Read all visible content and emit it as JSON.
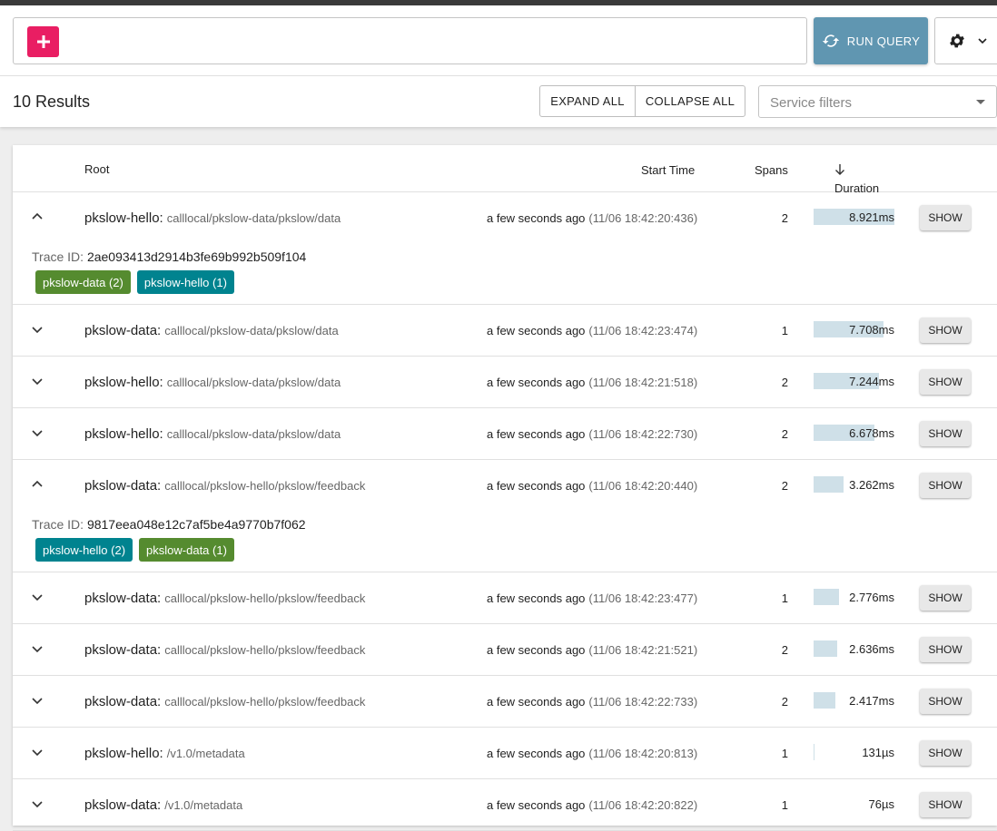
{
  "query": {
    "add_label": "+",
    "run_label": "RUN QUERY"
  },
  "results": {
    "count_label": "10 Results",
    "expand_all": "EXPAND ALL",
    "collapse_all": "COLLAPSE ALL",
    "service_filter_placeholder": "Service filters"
  },
  "columns": {
    "root": "Root",
    "start_time": "Start Time",
    "spans": "Spans",
    "duration": "Duration"
  },
  "colors": {
    "add_button": "#e91e63",
    "run_button": "#6096b1",
    "duration_bar": "#cfe0e8",
    "chip_pkslow_data": "#558b2f",
    "chip_pkslow_hello": "#00838f"
  },
  "rows": [
    {
      "service": "pkslow-hello:",
      "operation": "calllocal/pkslow-data/pkslow/data",
      "relative": "a few seconds ago",
      "timestamp": "(11/06 18:42:20:436)",
      "spans": "2",
      "duration": "8.921ms",
      "duration_fraction": 1.0,
      "expanded": true,
      "show": "SHOW",
      "trace_label": "Trace ID:",
      "trace_id": "2ae093413d2914b3fe69b992b509f104",
      "chips": [
        {
          "label": "pkslow-data (2)",
          "color": "#558b2f"
        },
        {
          "label": "pkslow-hello (1)",
          "color": "#00838f"
        }
      ]
    },
    {
      "service": "pkslow-data:",
      "operation": "calllocal/pkslow-data/pkslow/data",
      "relative": "a few seconds ago",
      "timestamp": "(11/06 18:42:23:474)",
      "spans": "1",
      "duration": "7.708ms",
      "duration_fraction": 0.864,
      "expanded": false,
      "show": "SHOW"
    },
    {
      "service": "pkslow-hello:",
      "operation": "calllocal/pkslow-data/pkslow/data",
      "relative": "a few seconds ago",
      "timestamp": "(11/06 18:42:21:518)",
      "spans": "2",
      "duration": "7.244ms",
      "duration_fraction": 0.812,
      "expanded": false,
      "show": "SHOW"
    },
    {
      "service": "pkslow-hello:",
      "operation": "calllocal/pkslow-data/pkslow/data",
      "relative": "a few seconds ago",
      "timestamp": "(11/06 18:42:22:730)",
      "spans": "2",
      "duration": "6.678ms",
      "duration_fraction": 0.749,
      "expanded": false,
      "show": "SHOW"
    },
    {
      "service": "pkslow-data:",
      "operation": "calllocal/pkslow-hello/pkslow/feedback",
      "relative": "a few seconds ago",
      "timestamp": "(11/06 18:42:20:440)",
      "spans": "2",
      "duration": "3.262ms",
      "duration_fraction": 0.366,
      "expanded": true,
      "show": "SHOW",
      "trace_label": "Trace ID:",
      "trace_id": "9817eea048e12c7af5be4a9770b7f062",
      "chips": [
        {
          "label": "pkslow-hello (2)",
          "color": "#00838f"
        },
        {
          "label": "pkslow-data (1)",
          "color": "#558b2f"
        }
      ]
    },
    {
      "service": "pkslow-data:",
      "operation": "calllocal/pkslow-hello/pkslow/feedback",
      "relative": "a few seconds ago",
      "timestamp": "(11/06 18:42:23:477)",
      "spans": "1",
      "duration": "2.776ms",
      "duration_fraction": 0.311,
      "expanded": false,
      "show": "SHOW"
    },
    {
      "service": "pkslow-data:",
      "operation": "calllocal/pkslow-hello/pkslow/feedback",
      "relative": "a few seconds ago",
      "timestamp": "(11/06 18:42:21:521)",
      "spans": "2",
      "duration": "2.636ms",
      "duration_fraction": 0.295,
      "expanded": false,
      "show": "SHOW"
    },
    {
      "service": "pkslow-data:",
      "operation": "calllocal/pkslow-hello/pkslow/feedback",
      "relative": "a few seconds ago",
      "timestamp": "(11/06 18:42:22:733)",
      "spans": "2",
      "duration": "2.417ms",
      "duration_fraction": 0.271,
      "expanded": false,
      "show": "SHOW"
    },
    {
      "service": "pkslow-hello:",
      "operation": "/v1.0/metadata",
      "relative": "a few seconds ago",
      "timestamp": "(11/06 18:42:20:813)",
      "spans": "1",
      "duration": "131µs",
      "duration_fraction": 0.015,
      "expanded": false,
      "show": "SHOW"
    },
    {
      "service": "pkslow-data:",
      "operation": "/v1.0/metadata",
      "relative": "a few seconds ago",
      "timestamp": "(11/06 18:42:20:822)",
      "spans": "1",
      "duration": "76µs",
      "duration_fraction": 0.0,
      "expanded": false,
      "show": "SHOW"
    }
  ]
}
